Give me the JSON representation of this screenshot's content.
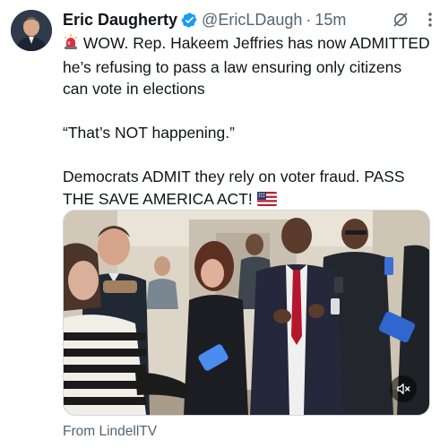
{
  "author": {
    "display_name": "Eric Daugherty",
    "handle": "@EricLDaugh",
    "separator": "·",
    "time": "15m",
    "verified": true,
    "avatar_icon": "profile-photo"
  },
  "tweet": {
    "line1": "WOW. Rep. Hakeem Jeffries has now ADMITTED he’s refusing to pass a law ensuring only citizens can vote in elections",
    "line2": "“That’s NOT happening.”",
    "line3": "Democrats ADMIT they rely on voter fraud. PASS THE SAVE AMERICA ACT!",
    "leading_emoji": "siren-emoji",
    "trailing_emoji": "us-flag-emoji"
  },
  "media": {
    "type": "video",
    "mute_icon": "muted-speaker-icon"
  },
  "attribution": "From LindellTV",
  "colors": {
    "text": "#0f1419",
    "secondary": "#536471",
    "verified_blue": "#1d9bf0"
  }
}
